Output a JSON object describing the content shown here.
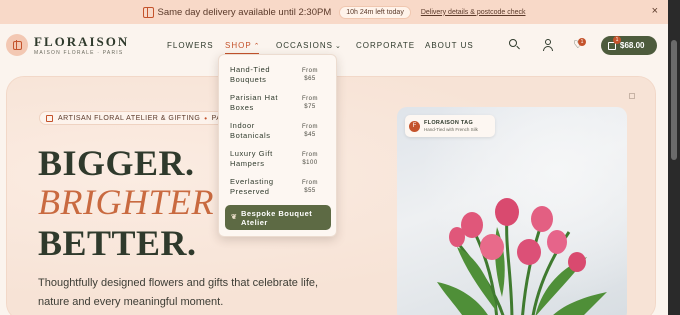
{
  "announcement": {
    "message": "Same day delivery available until 2:30PM",
    "timer": "10h 24m left today",
    "link": "Delivery details & postcode check",
    "close": "×"
  },
  "header": {
    "logo_name": "FLORAISON",
    "logo_sub": "MAISON FLORALE · PARIS",
    "nav": [
      {
        "label": "FLOWERS"
      },
      {
        "label": "SHOP"
      },
      {
        "label": "OCCASIONS"
      },
      {
        "label": "CORPORATE"
      },
      {
        "label": "ABOUT US"
      }
    ],
    "wishlist_count": "1",
    "cart_count": "1",
    "cart_total": "$68.00"
  },
  "dropdown": {
    "items": [
      {
        "name": "Hand-Tied Bouquets",
        "price_prefix": "From",
        "price": "$65"
      },
      {
        "name": "Parisian Hat Boxes",
        "price_prefix": "From",
        "price": "$75"
      },
      {
        "name": "Indoor Botanicals",
        "price_prefix": "From",
        "price": "$45"
      },
      {
        "name": "Luxury Gift Hampers",
        "price_prefix": "From",
        "price": "$100"
      },
      {
        "name": "Everlasting Preserved",
        "price_prefix": "From",
        "price": "$55"
      }
    ],
    "cta": "Bespoke Bouquet Atelier"
  },
  "hero": {
    "pill_left": "ARTISAN FLORAL ATELIER & GIFTING",
    "pill_right": "PARIS &",
    "headline": [
      "BIGGER.",
      "BRIGHTER",
      "BETTER."
    ],
    "lead": [
      "Thoughtfully designed flowers and gifts that celebrate life,",
      "nature and every meaningful moment."
    ],
    "tag_title": "FLORAISON TAG",
    "tag_sub": "Hand-Tied with French Silk",
    "tag_icon_letter": "F"
  },
  "colors": {
    "brand_green": "#4d5b3c",
    "accent": "#c4532c",
    "announce_bg": "#f8d9c8"
  }
}
